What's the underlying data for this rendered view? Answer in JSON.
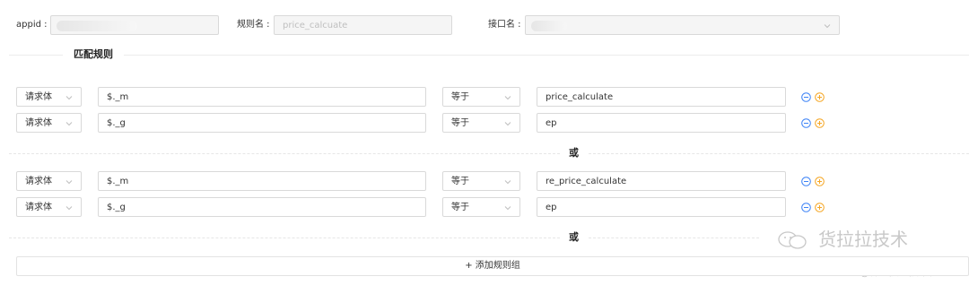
{
  "header": {
    "appid_label": "appid :",
    "rule_name_label": "规则名 :",
    "rule_name_value": "price_calcuate",
    "interface_name_label": "接口名 :"
  },
  "section": {
    "match_rules_title": "匹配规则"
  },
  "groups": [
    {
      "rules": [
        {
          "source": "请求体",
          "path": "$._m",
          "operator": "等于",
          "value": "price_calculate"
        },
        {
          "source": "请求体",
          "path": "$._g",
          "operator": "等于",
          "value": "ep"
        }
      ],
      "separator": "或"
    },
    {
      "rules": [
        {
          "source": "请求体",
          "path": "$._m",
          "operator": "等于",
          "value": "re_price_calculate"
        },
        {
          "source": "请求体",
          "path": "$._g",
          "operator": "等于",
          "value": "ep"
        }
      ],
      "separator": "或"
    }
  ],
  "footer": {
    "add_group_label": "+ 添加规则组"
  },
  "watermark": {
    "brand": "货拉拉技术",
    "community": "@稀土掘金技术社区"
  },
  "colors": {
    "remove_icon": "#3b82f6",
    "add_icon": "#f5a623"
  }
}
